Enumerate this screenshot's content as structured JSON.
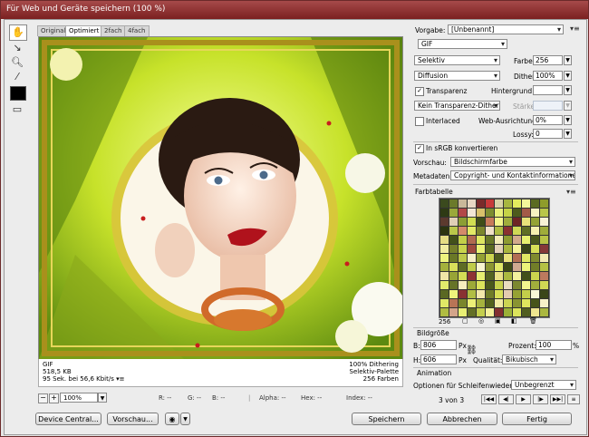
{
  "window": {
    "title": "Für Web und Geräte speichern (100 %)"
  },
  "tabs": [
    {
      "label": "Original",
      "active": false
    },
    {
      "label": "Optimiert",
      "active": true
    },
    {
      "label": "2fach",
      "active": false
    },
    {
      "label": "4fach",
      "active": false
    }
  ],
  "image_info": {
    "format": "GIF",
    "size": "518,5 KB",
    "time": "95 Sek. bei 56,6 Kbit/s",
    "dither": "100% Dithering",
    "palette": "Selektiv-Palette",
    "colors": "256 Farben"
  },
  "status": {
    "zoom": "100%",
    "r": "R: --",
    "g": "G: --",
    "b": "B: --",
    "alpha": "Alpha: --",
    "hex": "Hex: --",
    "index": "Index: --"
  },
  "buttons": {
    "device_central": "Device Central...",
    "preview": "Vorschau...",
    "save": "Speichern",
    "cancel": "Abbrechen",
    "done": "Fertig"
  },
  "settings": {
    "preset_label": "Vorgabe:",
    "preset_value": "[Unbenannt]",
    "format": "GIF",
    "reduction": "Selektiv",
    "colors_label": "Farben:",
    "colors_value": "256",
    "dither_algo": "Diffusion",
    "dither_label": "Dither:",
    "dither_value": "100%",
    "transparency_label": "Transparenz",
    "transparency_checked": true,
    "matte_label": "Hintergrund:",
    "transp_dither": "Kein Transparenz-Dither",
    "amount_label": "Stärke:",
    "interlaced_label": "Interlaced",
    "interlaced_checked": false,
    "web_snap_label": "Web-Ausrichtung:",
    "web_snap_value": "0%",
    "lossy_label": "Lossy:",
    "lossy_value": "0",
    "srgb_label": "In sRGB konvertieren",
    "srgb_checked": true,
    "preview_label": "Vorschau:",
    "preview_value": "Bildschirmfarbe",
    "metadata_label": "Metadaten:",
    "metadata_value": "Copyright- und Kontaktinformationen"
  },
  "color_table": {
    "title": "Farbtabelle",
    "count": "256",
    "colors": [
      "#3b4a1e",
      "#6b7a2a",
      "#c9b89a",
      "#e8d7c3",
      "#7a2b2b",
      "#c73a3a",
      "#d9d2a8",
      "#a7b640",
      "#e3ec5e",
      "#f3f79a",
      "#5a6b22",
      "#8f9c2b",
      "#2e3a14",
      "#9aa83a",
      "#b24848",
      "#f2e6d6",
      "#d8c06b",
      "#7d8c30",
      "#e9ef7a",
      "#c5d346",
      "#4d5b1c",
      "#a35a48",
      "#f7f2c2",
      "#b9c64a",
      "#5c3a2e",
      "#e0cfb6",
      "#8c9e34",
      "#d0dd52",
      "#3f4d18",
      "#c77a5a",
      "#f4f58c",
      "#a0ad3c",
      "#6e2424",
      "#e8e27a",
      "#94a236",
      "#f9f3d4",
      "#2c3410",
      "#bbc84a",
      "#d48a6a",
      "#e2ea66",
      "#7b862c",
      "#f0e0c8",
      "#aebc42",
      "#8a3030",
      "#cfd856",
      "#5f6e24",
      "#f6f0b0",
      "#9fac3a",
      "#e5dd84",
      "#43511a",
      "#c2cf48",
      "#b06a50",
      "#dde560",
      "#697828",
      "#f3ecb8",
      "#8e9b32",
      "#d2aa8c",
      "#e7f070",
      "#4a581e",
      "#b8c446",
      "#f1eda0",
      "#767f2a",
      "#c8d44c",
      "#9e4a3e",
      "#ebf276",
      "#5b6a22",
      "#e4d2b8",
      "#a9b63e",
      "#f5f39a",
      "#38441a",
      "#d6de58",
      "#853838",
      "#eef47e",
      "#6a7826",
      "#bcc848",
      "#f7f0c6",
      "#93a034",
      "#cdd650",
      "#4e5c1e",
      "#e9e37c",
      "#b36e54",
      "#dfe764",
      "#7f8a2e",
      "#f2eab2",
      "#a4b13c",
      "#d9e05a",
      "#5e6c24",
      "#c0cc4a",
      "#f8f5d0",
      "#8b9632",
      "#e1e96a",
      "#3d4a16",
      "#cfa890",
      "#edf37a",
      "#717e28",
      "#b5c144",
      "#f0e6a6",
      "#98a436",
      "#d4dc56",
      "#8e3434",
      "#e6ee72",
      "#556322",
      "#ebe088",
      "#abb840",
      "#f4f29e",
      "#42501a",
      "#cad44e",
      "#bd7a5e",
      "#e2ea6c",
      "#677428",
      "#f6eebe",
      "#9da938",
      "#dbe25c",
      "#4b581c",
      "#c6d04c",
      "#e8dcc0",
      "#7c8830",
      "#f2f48e",
      "#a1ae3c",
      "#d0d854",
      "#5a6822",
      "#eef27c",
      "#893232",
      "#b2be44",
      "#f3e8ac",
      "#6f7c28",
      "#d7df58",
      "#e4cbb0",
      "#96a234",
      "#c3ce4a",
      "#f9f6d8",
      "#3a4618",
      "#e0e866",
      "#b87456",
      "#7a862c",
      "#ecf078",
      "#a6b33e",
      "#54621e",
      "#f1eaa4",
      "#cbd452",
      "#8a9432",
      "#deE55e",
      "#47541a",
      "#f7f1c8",
      "#b0bc42",
      "#d3a48a",
      "#e9ef74",
      "#646f26",
      "#c4ce4c",
      "#f4f09a",
      "#833030",
      "#9bb038",
      "#dce45c",
      "#515e20",
      "#efe590",
      "#aab740"
    ]
  },
  "image_size": {
    "title": "Bildgröße",
    "w_label": "B:",
    "w_value": "806",
    "h_label": "H:",
    "h_value": "606",
    "unit": "Px",
    "percent_label": "Prozent:",
    "percent_value": "100",
    "percent_unit": "%",
    "quality_label": "Qualität:",
    "quality_value": "Bikubisch"
  },
  "animation": {
    "title": "Animation",
    "loop_label": "Optionen für Schleifenwiedergabe:",
    "loop_value": "Unbegrenzt",
    "frame": "3 von 3"
  }
}
